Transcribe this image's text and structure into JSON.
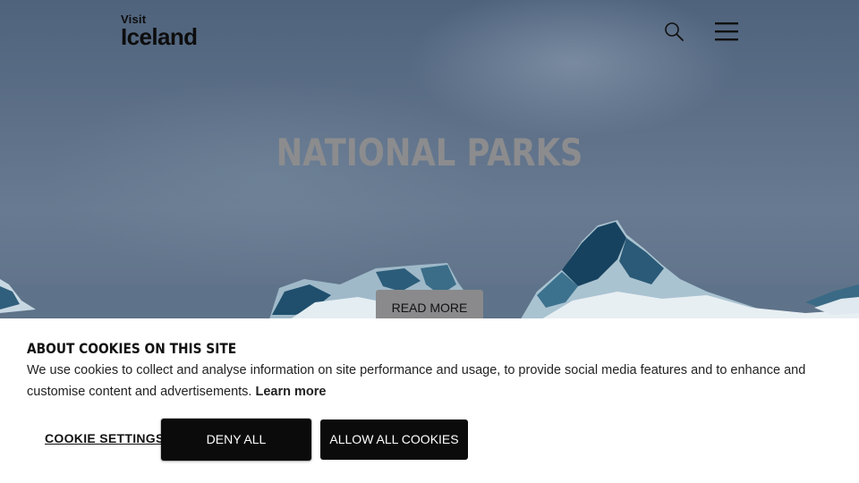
{
  "header": {
    "logo_small": "Visit",
    "logo_big": "Iceland",
    "icons": [
      "search-icon",
      "hamburger-menu-icon"
    ]
  },
  "hero": {
    "title": "NATIONAL PARKS",
    "read_more_label": "READ MORE"
  },
  "cookie_banner": {
    "title": "ABOUT COOKIES ON THIS SITE",
    "text": "We use cookies to collect and analyse information on site performance and usage, to provide social media features and to enhance and customise content and advertisements.",
    "learn_more_label": "Learn more",
    "settings_label": "COOKIE SETTINGS",
    "deny_label": "DENY ALL",
    "allow_label": "ALLOW ALL COOKIES"
  },
  "colors": {
    "banner_background": "#ffffff",
    "button_dark": "#0b0b0b",
    "hero_title": "#8c8c8e"
  }
}
